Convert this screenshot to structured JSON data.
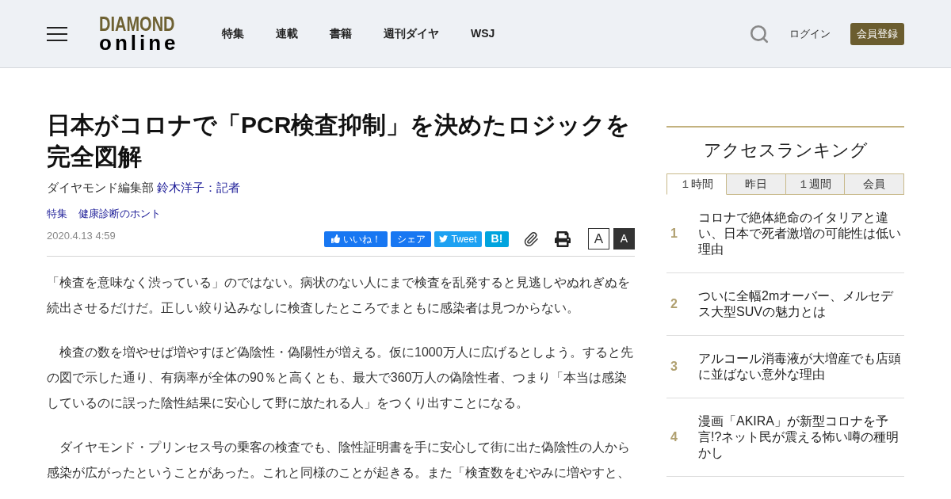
{
  "header": {
    "logo": {
      "top": "DIAMOND",
      "bottom": "online"
    },
    "nav": [
      "特集",
      "連載",
      "書籍",
      "週刊ダイヤ",
      "WSJ"
    ],
    "login": "ログイン",
    "register": "会員登録"
  },
  "article": {
    "title": "日本がコロナで「PCR検査抑制」を決めたロジックを完全図解",
    "byline": {
      "desk": "ダイヤモンド編集部",
      "author": "鈴木洋子：記者"
    },
    "tags": [
      "特集",
      "健康診断のホント"
    ],
    "date": "2020.4.13 4:59",
    "share": [
      {
        "kind": "like",
        "label": "いいね！"
      },
      {
        "kind": "share",
        "label": "シェア"
      },
      {
        "kind": "tweet",
        "label": "Tweet"
      },
      {
        "kind": "hatena",
        "label": "B!"
      }
    ],
    "font_sizes": [
      {
        "label": "A",
        "selected": false
      },
      {
        "label": "A",
        "selected": true
      }
    ],
    "paragraphs": [
      "「検査を意味なく渋っている」のではない。病状のない人にまで検査を乱発すると見逃しやぬれぎぬを続出させるだけだ。正しい絞り込みなしに検査したところでまともに感染者は見つからない。",
      "　検査の数を増やせば増やすほど偽陰性・偽陽性が増える。仮に1000万人に広げるとしよう。すると先の図で示した通り、有病率が全体の90％と高くとも、最大で360万人の偽陰性者、つまり「本当は感染しているのに誤った陰性結果に安心して野に放たれる人」をつくり出すことになる。",
      "　ダイヤモンド・プリンセス号の乗客の検査でも、陰性証明書を手に安心して街に出た偽陰性の人から感染が広がったということがあった。これと同様のことが起きる。また「検査数をむやみに増やすと、"
    ]
  },
  "ranking": {
    "title": "アクセスランキング",
    "tabs": [
      {
        "label": "１時間",
        "selected": true
      },
      {
        "label": "昨日",
        "selected": false
      },
      {
        "label": "１週間",
        "selected": false
      },
      {
        "label": "会員",
        "selected": false
      }
    ],
    "items": [
      {
        "rank": "1",
        "title": "コロナで絶体絶命のイタリアと違い、日本で死者激増の可能性は低い理由"
      },
      {
        "rank": "2",
        "title": "ついに全幅2mオーバー、メルセデス大型SUVの魅力とは"
      },
      {
        "rank": "3",
        "title": "アルコール消毒液が大増産でも店頭に並ばない意外な理由"
      },
      {
        "rank": "4",
        "title": "漫画「AKIRA」が新型コロナを予言!?ネット民が震える怖い噂の種明かし"
      }
    ]
  }
}
